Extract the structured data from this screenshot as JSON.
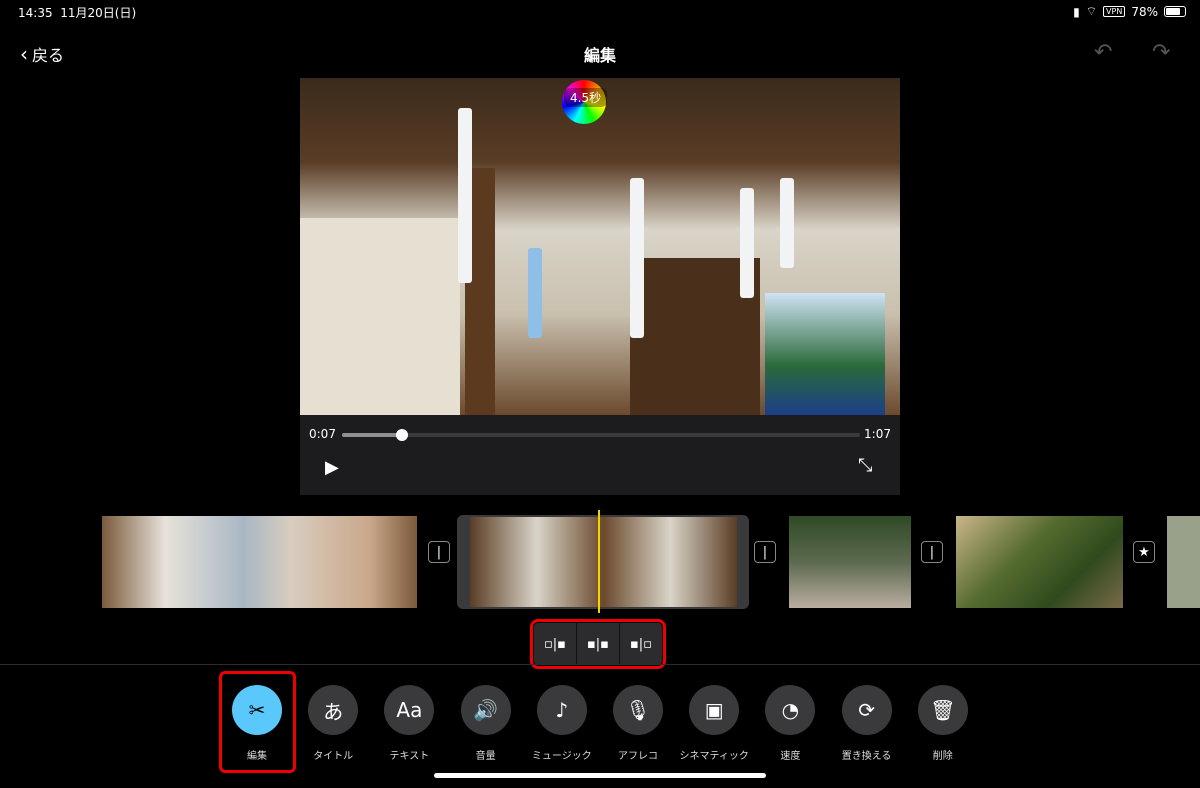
{
  "status": {
    "time": "14:35",
    "date": "11月20日(日)",
    "vpn": "VPN",
    "battery": "78%"
  },
  "nav": {
    "back": "戻る",
    "title": "編集"
  },
  "preview": {
    "duration_badge": "4.5秒",
    "current_time": "0:07",
    "total_time": "1:07",
    "progress": 0.115
  },
  "timeline": {
    "split_buttons": [
      "split-left",
      "split-center",
      "split-right"
    ]
  },
  "toolbar": [
    {
      "label": "編集",
      "icon": "✂",
      "name": "edit"
    },
    {
      "label": "タイトル",
      "icon": "あ",
      "name": "title"
    },
    {
      "label": "テキスト",
      "icon": "Aa",
      "name": "text"
    },
    {
      "label": "音量",
      "icon": "🔊",
      "name": "volume"
    },
    {
      "label": "ミュージック",
      "icon": "♪",
      "name": "music"
    },
    {
      "label": "アフレコ",
      "icon": "🎙",
      "name": "voiceover"
    },
    {
      "label": "シネマティック",
      "icon": "▣",
      "name": "cinematic"
    },
    {
      "label": "速度",
      "icon": "◔",
      "name": "speed"
    },
    {
      "label": "置き換える",
      "icon": "⟳",
      "name": "replace"
    },
    {
      "label": "削除",
      "icon": "🗑",
      "name": "delete"
    }
  ],
  "colors": {
    "accent": "#5ac8fa",
    "playhead": "#f5d300",
    "highlight": "#e00000"
  }
}
